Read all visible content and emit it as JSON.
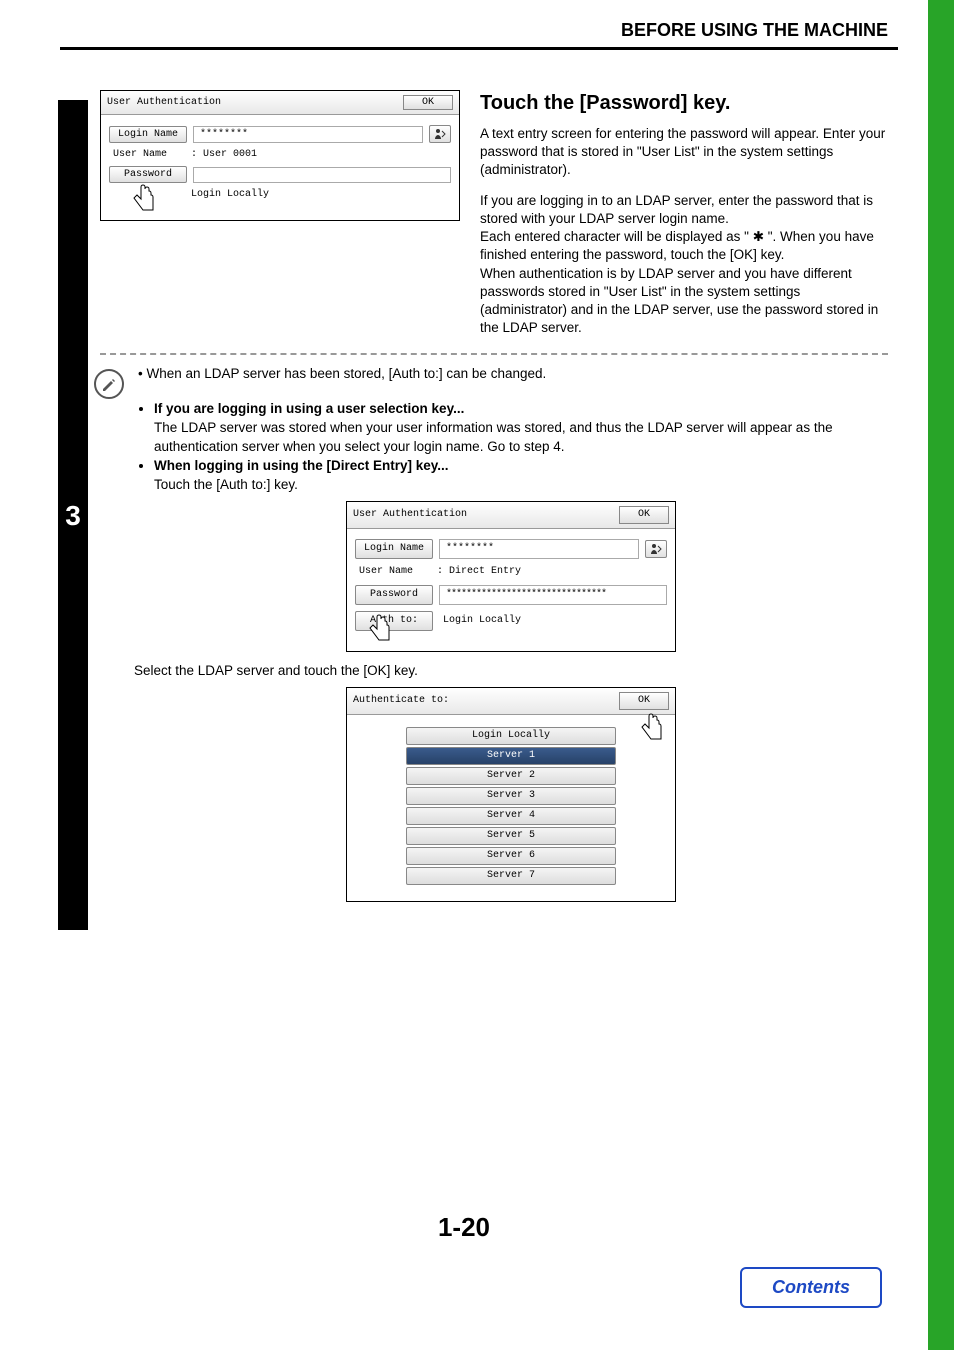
{
  "header": {
    "title": "BEFORE USING THE MACHINE"
  },
  "step": "3",
  "panel1": {
    "title": "User Authentication",
    "ok": "OK",
    "loginNameLabel": "Login Name",
    "loginNameValue": "********",
    "userNameLabel": "User Name",
    "userNameValue": ": User 0001",
    "passwordLabel": "Password",
    "authToValue": "Login Locally"
  },
  "instruction": {
    "title": "Touch the [Password] key.",
    "p1": "A text entry screen for entering the password will appear. Enter your password that is stored in \"User List\" in the system settings (administrator).",
    "p2": "If you are logging in to an LDAP server, enter the password that is stored with your LDAP server login name.",
    "p3": "Each entered character will be displayed as \" ✱ \". When you have finished entering the password, touch the [OK] key.",
    "p4": "When authentication is by LDAP server and you have different passwords stored in \"User List\" in the system settings (administrator) and in the LDAP server, use the password stored in the LDAP server."
  },
  "note": {
    "line1": "When an LDAP server has been stored, [Auth to:] can be changed.",
    "bold1": "If you are logging in using a user selection key...",
    "text1": "The LDAP server was stored when your user information was stored, and thus the LDAP server will appear as the authentication server when you select your login name. Go to step 4.",
    "bold2": "When logging in using the [Direct Entry] key...",
    "text2": "Touch the [Auth to:] key."
  },
  "panel2": {
    "title": "User Authentication",
    "ok": "OK",
    "loginNameLabel": "Login Name",
    "loginNameValue": "********",
    "userNameLabel": "User Name",
    "userNameValue": ": Direct Entry",
    "passwordLabel": "Password",
    "passwordValue": "********************************",
    "authToLabel": "Auth to:",
    "authToValue": "Login Locally"
  },
  "midText": "Select the LDAP server and touch the [OK] key.",
  "panel3": {
    "title": "Authenticate to:",
    "ok": "OK",
    "items": [
      "Login Locally",
      "Server 1",
      "Server 2",
      "Server 3",
      "Server 4",
      "Server 5",
      "Server 6",
      "Server 7"
    ],
    "selectedIndex": 1
  },
  "pageNumber": "1-20",
  "contents": "Contents"
}
